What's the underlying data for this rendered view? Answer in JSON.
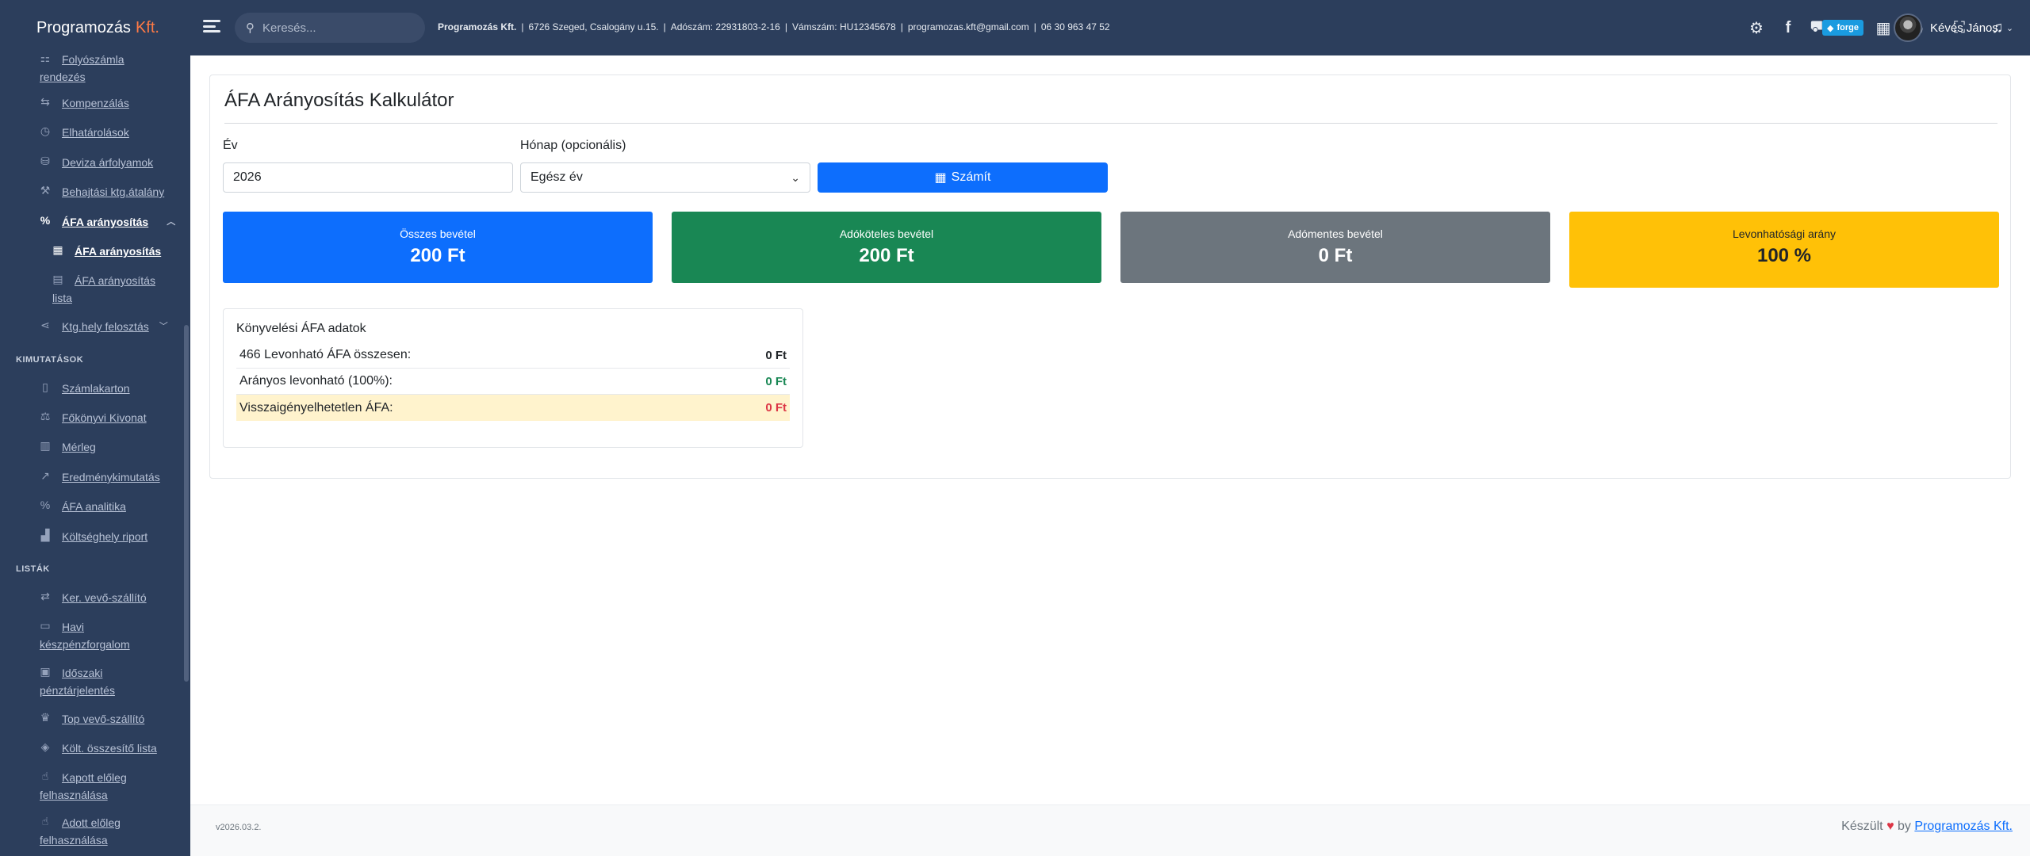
{
  "brand": {
    "name": "Programozás",
    "accent": "Kft."
  },
  "sidebar": {
    "items": [
      {
        "icon": "list-icon",
        "glyph": "☷",
        "label1": "Folyószámla",
        "label2": "rendezés"
      },
      {
        "icon": "compensation-icon",
        "glyph": "⇆",
        "label": "Kompenzálás"
      },
      {
        "icon": "clock-icon",
        "glyph": "◷",
        "label": "Elhatárolások"
      },
      {
        "icon": "coins-icon",
        "glyph": "⛁",
        "label": "Deviza árfolyamok"
      },
      {
        "icon": "hammer-icon",
        "glyph": "⚒",
        "label": "Behajtási ktg.átalány"
      },
      {
        "icon": "percent-icon",
        "glyph": "%",
        "label": "ÁFA arányosítás"
      },
      {
        "icon": "table-icon",
        "glyph": "▦",
        "label": "ÁFA arányosítás"
      },
      {
        "icon": "table-list-icon",
        "glyph": "▤",
        "label1": "ÁFA arányosítás",
        "label2": "lista"
      },
      {
        "icon": "share-icon",
        "glyph": "⋖",
        "label": "Ktg.hely felosztás"
      }
    ],
    "section_reports": "KIMUTATÁSOK",
    "reports": [
      {
        "icon": "file-icon",
        "glyph": "▯",
        "label": "Számlakarton"
      },
      {
        "icon": "scale-icon",
        "glyph": "⚖",
        "label": "Főkönyvi Kivonat"
      },
      {
        "icon": "columns-icon",
        "glyph": "▥",
        "label": "Mérleg"
      },
      {
        "icon": "chart-line-icon",
        "glyph": "↗",
        "label": "Eredménykimutatás"
      },
      {
        "icon": "percent-icon",
        "glyph": "%",
        "label": "ÁFA analitika"
      },
      {
        "icon": "chart-bar-icon",
        "glyph": "▟",
        "label": "Költséghely riport"
      }
    ],
    "section_lists": "LISTÁK",
    "lists": [
      {
        "icon": "exchange-icon",
        "glyph": "⇄",
        "label": "Ker. vevő-szállító"
      },
      {
        "icon": "money-icon",
        "glyph": "▭",
        "label1": "Havi",
        "label2": "készpénzforgalom"
      },
      {
        "icon": "cash-register-icon",
        "glyph": "▣",
        "label1": "Időszaki",
        "label2": "pénztárjelentés"
      },
      {
        "icon": "trophy-icon",
        "glyph": "♛",
        "label": "Top vevő-szállító"
      },
      {
        "icon": "layers-icon",
        "glyph": "◈",
        "label": "Költ. összesítő lista"
      },
      {
        "icon": "hand-coin-icon",
        "glyph": "☝",
        "label1": "Kapott előleg",
        "label2": "felhasználása"
      },
      {
        "icon": "hand-coin-icon",
        "glyph": "☝",
        "label1": "Adott előleg",
        "label2": "felhasználása"
      }
    ]
  },
  "topbar": {
    "search_placeholder": "Keresés...",
    "company_name": "Programozás Kft.",
    "address": "6726 Szeged, Csalogány u.15.",
    "tax_number": "Adószám: 22931803-2-16",
    "vat_number": "Vámszám: HU12345678",
    "email": "programozas.kft@gmail.com",
    "phone": "06 30 963 47 52",
    "forge_label": "forge",
    "user_name": "Kévés János"
  },
  "calculator": {
    "title": "ÁFA Arányosítás Kalkulátor",
    "year_label": "Év",
    "year_value": "2026",
    "month_label": "Hónap (opcionális)",
    "month_value": "Egész év",
    "calc_button": "Számít",
    "stats": {
      "total_label": "Összes bevétel",
      "total_value": "200 Ft",
      "taxable_label": "Adóköteles bevétel",
      "taxable_value": "200 Ft",
      "exempt_label": "Adómentes bevétel",
      "exempt_value": "0 Ft",
      "ratio_label": "Levonhatósági arány",
      "ratio_value": "100 %"
    },
    "book": {
      "title": "Könyvelési ÁFA adatok",
      "row1_label": "466 Levonható ÁFA összesen:",
      "row1_value": "0 Ft",
      "row2_label": "Arányos levonható (100%):",
      "row2_value": "0 Ft",
      "row3_label": "Visszaigényelhetetlen ÁFA:",
      "row3_value": "0 Ft"
    }
  },
  "footer": {
    "version": "v2026.03.2.",
    "made_prefix": "Készült",
    "made_by": "by",
    "made_link": "Programozás Kft."
  },
  "colors": {
    "sidebar_bg": "#2c3e5c",
    "primary": "#0d6efd",
    "success": "#198754",
    "secondary": "#6c757d",
    "warning": "#ffc107",
    "danger": "#dc3545",
    "brand_accent": "#ff7a45"
  }
}
